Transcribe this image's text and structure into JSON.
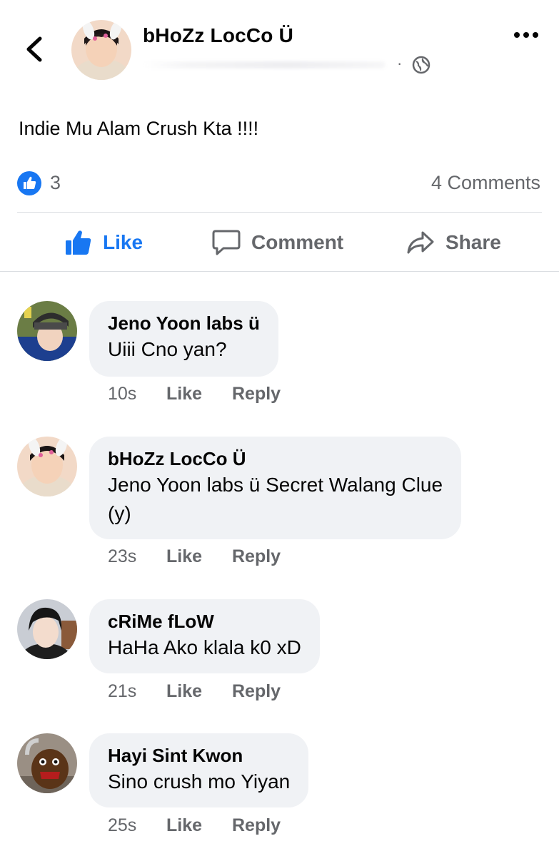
{
  "post": {
    "author": "bHoZz LocCo Ü",
    "meta_separator": "·",
    "text": "Indie Mu Alam Crush Kta !!!!",
    "reaction_count": "3",
    "comments_count": "4 Comments",
    "actions": {
      "like": "Like",
      "comment": "Comment",
      "share": "Share"
    }
  },
  "comments": [
    {
      "name": "Jeno Yoon labs ü",
      "text_lines": [
        "Uiii Cno yan?"
      ],
      "time": "10s",
      "like": "Like",
      "reply": "Reply"
    },
    {
      "name": "bHoZz LocCo Ü",
      "text_lines": [
        "Jeno Yoon labs ü Secret Walang Clue",
        "(y)"
      ],
      "time": "23s",
      "like": "Like",
      "reply": "Reply"
    },
    {
      "name": "cRiMe fLoW",
      "text_lines": [
        "HaHa Ako klala k0 xD"
      ],
      "time": "21s",
      "like": "Like",
      "reply": "Reply"
    },
    {
      "name": "Hayi Sint Kwon",
      "text_lines": [
        "Sino crush mo Yiyan"
      ],
      "time": "25s",
      "like": "Like",
      "reply": "Reply"
    }
  ],
  "colors": {
    "accent": "#1877f2",
    "secondary_text": "#65676b",
    "bubble": "#f0f2f5"
  },
  "icons": [
    "back-arrow-icon",
    "globe-icon",
    "more-options-icon",
    "like-reaction-icon",
    "thumbs-up-icon",
    "comment-icon",
    "share-icon"
  ]
}
